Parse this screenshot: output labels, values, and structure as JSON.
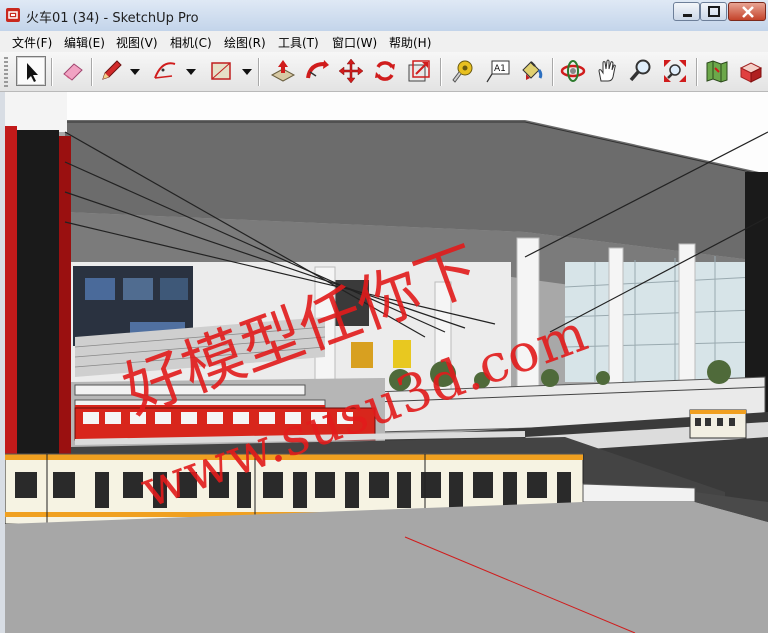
{
  "window": {
    "title": "火车01 (34) - SketchUp Pro"
  },
  "menubar": {
    "items": [
      {
        "label": "文件(F)"
      },
      {
        "label": "编辑(E)"
      },
      {
        "label": "视图(V)"
      },
      {
        "label": "相机(C)"
      },
      {
        "label": "绘图(R)"
      },
      {
        "label": "工具(T)"
      },
      {
        "label": "窗口(W)"
      },
      {
        "label": "帮助(H)"
      }
    ]
  },
  "toolbar": {
    "tools": [
      {
        "name": "select-tool",
        "icon": "arrow-cursor-icon",
        "selected": true
      },
      {
        "name": "eraser-tool",
        "icon": "eraser-icon"
      },
      {
        "name": "pencil-tool",
        "icon": "pencil-icon"
      },
      {
        "name": "arc-tool",
        "icon": "arc-icon"
      },
      {
        "name": "rectangle-tool",
        "icon": "rectangle-icon"
      },
      {
        "name": "push-pull-tool",
        "icon": "push-pull-icon"
      },
      {
        "name": "follow-me-tool",
        "icon": "follow-me-icon"
      },
      {
        "name": "move-tool",
        "icon": "move-arrows-icon"
      },
      {
        "name": "rotate-tool",
        "icon": "rotate-icon"
      },
      {
        "name": "scale-tool",
        "icon": "scale-icon"
      },
      {
        "name": "tape-measure-tool",
        "icon": "tape-measure-icon"
      },
      {
        "name": "text-tool",
        "icon": "text-label-icon",
        "label": "A1"
      },
      {
        "name": "paint-bucket-tool",
        "icon": "paint-bucket-icon"
      },
      {
        "name": "orbit-tool",
        "icon": "orbit-icon"
      },
      {
        "name": "pan-tool",
        "icon": "hand-icon"
      },
      {
        "name": "zoom-tool",
        "icon": "magnifier-icon"
      },
      {
        "name": "zoom-extents-tool",
        "icon": "zoom-extents-icon"
      },
      {
        "name": "warehouse-tool",
        "icon": "map-icon"
      },
      {
        "name": "extension-tool",
        "icon": "component-box-icon"
      }
    ]
  },
  "colors": {
    "titlebar": "#c3d4ea",
    "menubar": "#f0f0f0",
    "toolbar": "#e3e3e3",
    "close_button": "#c4432b",
    "watermark": "#e21b1b",
    "train_stripe": "#f0a020",
    "train_red": "#d8261c",
    "floor": "#a9a9a9"
  },
  "viewport": {
    "watermark_line1": "好模型任你下",
    "watermark_line2": "www.susu3d.com"
  }
}
